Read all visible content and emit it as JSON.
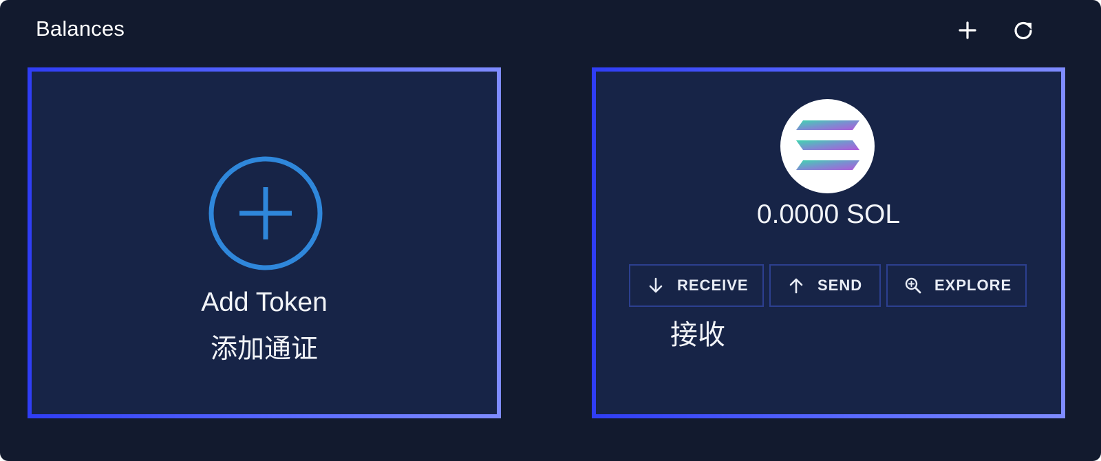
{
  "header": {
    "title": "Balances",
    "add_icon": "plus-icon",
    "refresh_icon": "refresh-icon"
  },
  "add_token_card": {
    "icon": "plus-circle-icon",
    "label": "Add Token",
    "label_zh": "添加通证"
  },
  "sol_card": {
    "logo_icon": "solana-logo-icon",
    "balance": "0.0000 SOL",
    "actions": [
      {
        "label": "RECEIVE",
        "icon": "arrow-down-icon"
      },
      {
        "label": "SEND",
        "icon": "arrow-up-icon"
      },
      {
        "label": "EXPLORE",
        "icon": "zoom-in-icon"
      }
    ],
    "receive_zh": "接收"
  },
  "colors": {
    "background": "#121a2e",
    "card": "#172447",
    "accent_blue": "#2f87db",
    "border_gradient": [
      "#2f3df5",
      "#7f8cff"
    ]
  }
}
